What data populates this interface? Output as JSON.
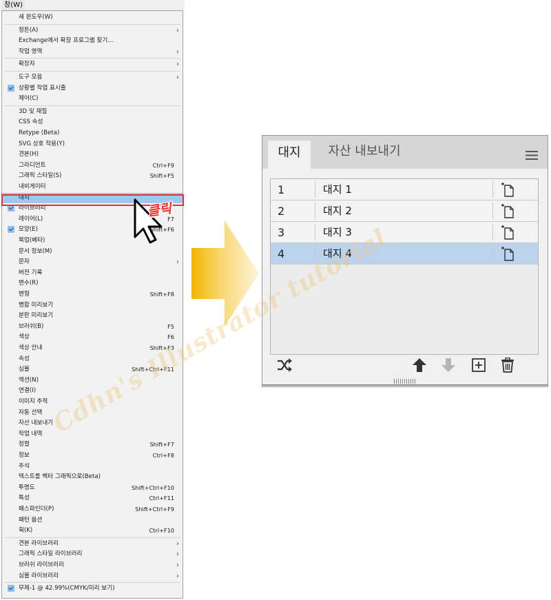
{
  "menubar": {
    "title": "창(W)"
  },
  "menu": {
    "items": [
      {
        "label": "새 윈도우(W)"
      },
      {
        "sep": true
      },
      {
        "label": "정돈(A)",
        "submenu": true
      },
      {
        "label": "Exchange에서 확장 프로그램 찾기..."
      },
      {
        "label": "작업 영역",
        "submenu": true
      },
      {
        "sep": true
      },
      {
        "label": "확장자",
        "submenu": true
      },
      {
        "sep": true
      },
      {
        "label": "도구 모음",
        "submenu": true
      },
      {
        "label": "상황별 작업 표시줄",
        "checked": true
      },
      {
        "label": "제어(C)"
      },
      {
        "sep": true
      },
      {
        "label": "3D 및 재질"
      },
      {
        "label": "CSS 속성"
      },
      {
        "label": "Retype (Beta)"
      },
      {
        "label": "SVG 상호 작용(Y)"
      },
      {
        "label": "견본(H)"
      },
      {
        "label": "그라디언트",
        "shortcut": "Ctrl+F9"
      },
      {
        "label": "그래픽 스타일(S)",
        "shortcut": "Shift+F5"
      },
      {
        "label": "내비게이터"
      },
      {
        "label": "대지",
        "highlighted": true
      },
      {
        "label": "라이브러리",
        "checked": true
      },
      {
        "label": "레이어(L)",
        "shortcut": "F7"
      },
      {
        "label": "모양(E)",
        "shortcut": "Shift+F6",
        "checked": true
      },
      {
        "label": "목업(베타)"
      },
      {
        "label": "문서 정보(M)"
      },
      {
        "label": "문자",
        "submenu": true
      },
      {
        "label": "버전 기록"
      },
      {
        "label": "변수(R)"
      },
      {
        "label": "변형",
        "shortcut": "Shift+F8"
      },
      {
        "label": "병합 미리보기"
      },
      {
        "label": "분판 미리보기"
      },
      {
        "label": "브러쉬(B)",
        "shortcut": "F5"
      },
      {
        "label": "색상",
        "shortcut": "F6"
      },
      {
        "label": "색상 안내",
        "shortcut": "Shift+F3"
      },
      {
        "label": "속성"
      },
      {
        "label": "심볼",
        "shortcut": "Shift+Ctrl+F11"
      },
      {
        "label": "액션(N)"
      },
      {
        "label": "연결(I)"
      },
      {
        "label": "이미지 추적"
      },
      {
        "label": "자동 선택"
      },
      {
        "label": "자산 내보내기"
      },
      {
        "label": "작업 내역"
      },
      {
        "label": "정렬",
        "shortcut": "Shift+F7"
      },
      {
        "label": "정보",
        "shortcut": "Ctrl+F8"
      },
      {
        "label": "주석"
      },
      {
        "label": "텍스트를 벡터 그래픽으로(Beta)"
      },
      {
        "label": "투명도",
        "shortcut": "Shift+Ctrl+F10"
      },
      {
        "label": "특성",
        "shortcut": "Ctrl+F11"
      },
      {
        "label": "패스파인더(P)",
        "shortcut": "Shift+Ctrl+F9"
      },
      {
        "label": "패턴 옵션"
      },
      {
        "label": "획(K)",
        "shortcut": "Ctrl+F10"
      },
      {
        "sep": true
      },
      {
        "label": "견본 라이브러리",
        "submenu": true
      },
      {
        "label": "그래픽 스타일 라이브러리",
        "submenu": true
      },
      {
        "label": "브러쉬 라이브러리",
        "submenu": true
      },
      {
        "label": "심볼 라이브러리",
        "submenu": true
      },
      {
        "sep": true
      },
      {
        "label": "무제-1 @ 42.99%(CMYK/미리 보기)",
        "checked": true
      }
    ]
  },
  "annotation": {
    "click_label": "클릭"
  },
  "panel": {
    "tabs": [
      {
        "label": "대지",
        "active": true
      },
      {
        "label": "자산 내보내기",
        "active": false
      }
    ],
    "artboards": [
      {
        "index": "1",
        "name": "대지 1",
        "selected": false
      },
      {
        "index": "2",
        "name": "대지 2",
        "selected": false
      },
      {
        "index": "3",
        "name": "대지 3",
        "selected": false
      },
      {
        "index": "4",
        "name": "대지 4",
        "selected": true
      }
    ],
    "icons": {
      "menu": "hamburger-icon",
      "artboard_options": "artboard-options-icon",
      "rearrange": "rearrange-artboards-icon",
      "move_up": "move-up-icon",
      "move_down": "move-down-icon",
      "new": "new-artboard-icon",
      "delete": "trash-icon"
    }
  },
  "watermark": {
    "text": "Cdhn's Illustrator tutorial"
  },
  "colors": {
    "menu_highlight": "#9cc9f2",
    "annotation_red": "#e53030",
    "selected_row": "#bcd3ee",
    "arrow_gold": "#f4b400"
  }
}
